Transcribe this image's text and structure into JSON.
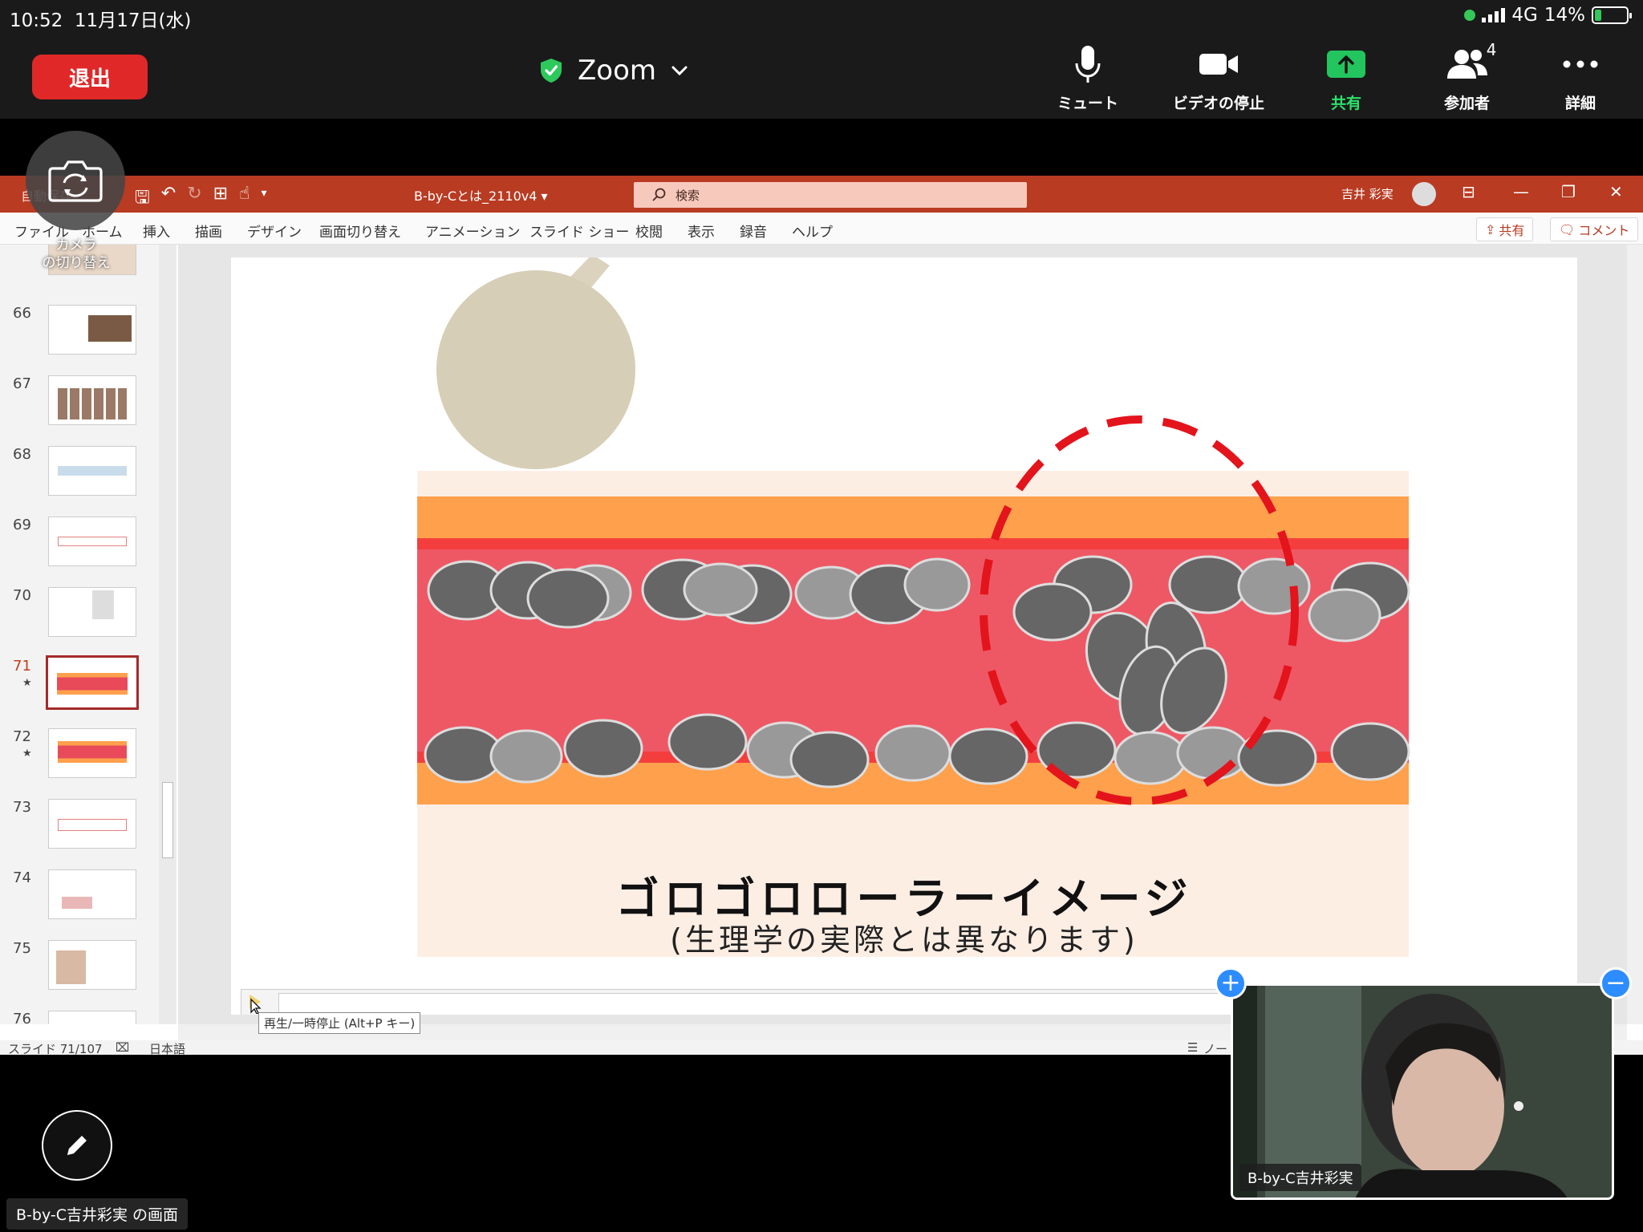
{
  "status": {
    "time": "10:52",
    "date": "11月17日(水)",
    "network": "4G",
    "battery": "14%"
  },
  "zoom": {
    "leave_label": "退出",
    "meeting_title": "Zoom",
    "controls": {
      "mute": "ミュート",
      "video": "ビデオの停止",
      "share": "共有",
      "participants": "参加者",
      "participant_count": "4",
      "more": "詳細"
    },
    "camera_switch_label": "カメラ\nの切り替え",
    "video_tile_name": "B-by-C吉井彩実",
    "screen_label": "B-by-C吉井彩実 の画面"
  },
  "ppt": {
    "autosave": "自動保存",
    "file_name": "B-by-Cとは_2110v4 ▾",
    "search_placeholder": "検索",
    "user_name": "吉井 彩実",
    "menu": [
      "ファイル",
      "ホーム",
      "挿入",
      "描画",
      "デザイン",
      "画面切り替え",
      "アニメーション",
      "スライド ショー",
      "校閲",
      "表示",
      "録音",
      "ヘルプ"
    ],
    "share_button": "共有",
    "comment_button": "コメント",
    "slides": [
      {
        "num": "66",
        "star": ""
      },
      {
        "num": "67",
        "star": ""
      },
      {
        "num": "68",
        "star": ""
      },
      {
        "num": "69",
        "star": ""
      },
      {
        "num": "70",
        "star": ""
      },
      {
        "num": "71",
        "star": "★"
      },
      {
        "num": "72",
        "star": "★"
      },
      {
        "num": "73",
        "star": ""
      },
      {
        "num": "74",
        "star": ""
      },
      {
        "num": "75",
        "star": ""
      },
      {
        "num": "76",
        "star": ""
      }
    ],
    "active_slide": "71",
    "slide": {
      "title": "ゴロゴロローラーイメージ",
      "subtitle": "(生理学の実際とは異なります)"
    },
    "tooltip": "再生/一時停止 (Alt+P キー)",
    "status_slide": "スライド 71/107",
    "status_lang": "日本語",
    "status_notes": "ノート"
  },
  "colors": {
    "ppt_accent": "#b83b22",
    "leave_red": "#e02828",
    "share_green": "#22c55e",
    "zoom_blue": "#2d8cff"
  }
}
